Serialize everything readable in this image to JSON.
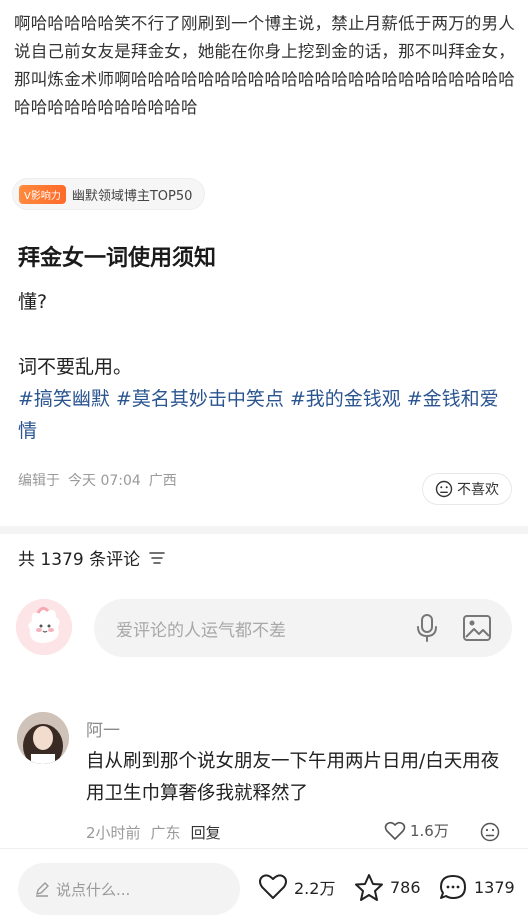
{
  "post": {
    "quote_text": "啊哈哈哈哈哈笑不行了刚刷到一个博主说，禁止月薪低于两万的男人说自己前女友是拜金女，她能在你身上挖到金的话，那不叫拜金女，那叫炼金术师啊哈哈哈哈哈哈哈哈哈哈哈哈哈哈哈哈哈哈哈哈哈哈哈哈哈哈哈哈哈哈哈哈哈哈",
    "badge": {
      "icon_text": "V影响力",
      "label": "幽默领域博主TOP50"
    },
    "title": "拜金女一词使用须知",
    "body_line1": "懂?",
    "body_line2": "词不要乱用。",
    "tags": [
      "#搞笑幽默",
      "#莫名其妙击中笑点",
      "#我的金钱观",
      "#金钱和爱情"
    ],
    "meta": {
      "edited": "编辑于",
      "time": "今天 07:04",
      "location": "广西"
    },
    "dislike_label": "不喜欢"
  },
  "comments_section": {
    "header": "共 1379 条评论",
    "input_placeholder": "爱评论的人运气都不差"
  },
  "comment": {
    "username": "阿一",
    "text": "自从刷到那个说女朋友一下午用两片日用/白天用夜用卫生巾算奢侈我就释然了",
    "time": "2小时前",
    "location": "广东",
    "reply_label": "回复",
    "likes": "1.6万"
  },
  "bottom_bar": {
    "say_placeholder": "说点什么...",
    "likes": "2.2万",
    "favorites": "786",
    "comments": "1379"
  },
  "colors": {
    "tag": "#2a5591",
    "badge": "#ff7a2f",
    "muted": "#9a9a9a"
  }
}
